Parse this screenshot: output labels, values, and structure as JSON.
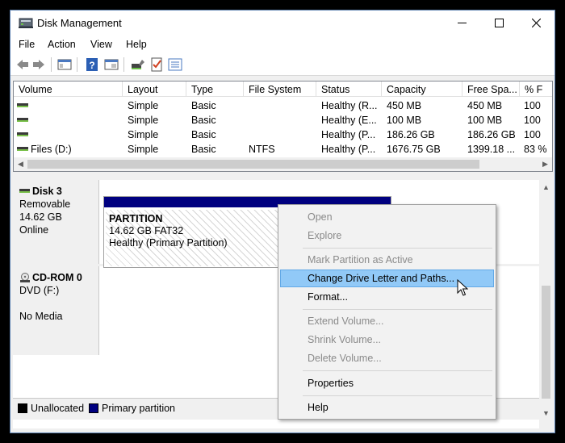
{
  "window": {
    "title": "Disk Management"
  },
  "menu": [
    "File",
    "Action",
    "View",
    "Help"
  ],
  "list": {
    "columns": [
      "Volume",
      "Layout",
      "Type",
      "File System",
      "Status",
      "Capacity",
      "Free Spa...",
      "% F"
    ],
    "rows": [
      {
        "volume": "",
        "layout": "Simple",
        "type": "Basic",
        "fs": "",
        "status": "Healthy (R...",
        "capacity": "450 MB",
        "free": "450 MB",
        "pct": "100"
      },
      {
        "volume": "",
        "layout": "Simple",
        "type": "Basic",
        "fs": "",
        "status": "Healthy (E...",
        "capacity": "100 MB",
        "free": "100 MB",
        "pct": "100"
      },
      {
        "volume": "",
        "layout": "Simple",
        "type": "Basic",
        "fs": "",
        "status": "Healthy (P...",
        "capacity": "186.26 GB",
        "free": "186.26 GB",
        "pct": "100"
      },
      {
        "volume": "Files (D:)",
        "layout": "Simple",
        "type": "Basic",
        "fs": "NTFS",
        "status": "Healthy (P...",
        "capacity": "1676.75 GB",
        "free": "1399.18 ...",
        "pct": "83 %"
      }
    ]
  },
  "disks": [
    {
      "name": "Disk 3",
      "line1": "Removable",
      "line2": "14.62 GB",
      "line3": "Online"
    },
    {
      "name": "CD-ROM 0",
      "line1": "DVD (F:)",
      "line2": "",
      "line3": "No Media"
    }
  ],
  "partition": {
    "name": "PARTITION",
    "size": "14.62 GB FAT32",
    "status": "Healthy (Primary Partition)"
  },
  "legend": {
    "unallocated": "Unallocated",
    "primary": "Primary partition",
    "unallocated_color": "#000000",
    "primary_color": "#000080"
  },
  "context_menu": {
    "open": "Open",
    "explore": "Explore",
    "mark_active": "Mark Partition as Active",
    "change_letter": "Change Drive Letter and Paths...",
    "format": "Format...",
    "extend": "Extend Volume...",
    "shrink": "Shrink Volume...",
    "delete": "Delete Volume...",
    "properties": "Properties",
    "help": "Help"
  },
  "colors": {
    "selection": "#91c9f7",
    "partition_header": "#000080"
  }
}
